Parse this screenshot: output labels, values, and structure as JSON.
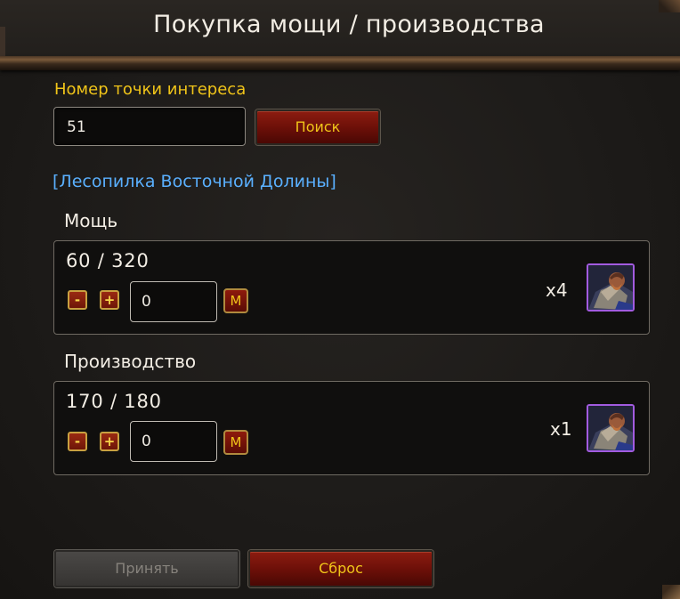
{
  "header": {
    "title": "Покупка мощи / производства"
  },
  "poi": {
    "label": "Номер точки интереса",
    "value": "51",
    "search_label": "Поиск"
  },
  "location": {
    "name": "[Лесопилка Восточной Долины]"
  },
  "power": {
    "label": "Мощь",
    "progress": "60 / 320",
    "minus": "-",
    "plus": "+",
    "quantity": "0",
    "max_label": "M",
    "multiplier": "x4",
    "icon": "lumberjack-worker-icon"
  },
  "production": {
    "label": "Производство",
    "progress": "170 / 180",
    "minus": "-",
    "plus": "+",
    "quantity": "0",
    "max_label": "M",
    "multiplier": "x1",
    "icon": "lumberjack-worker-icon"
  },
  "footer": {
    "accept_label": "Принять",
    "reset_label": "Сброс"
  },
  "colors": {
    "gold": "#f0c419",
    "link": "#5ab0ff",
    "button_red": "#8c1c10",
    "icon_border": "#a25be0"
  }
}
